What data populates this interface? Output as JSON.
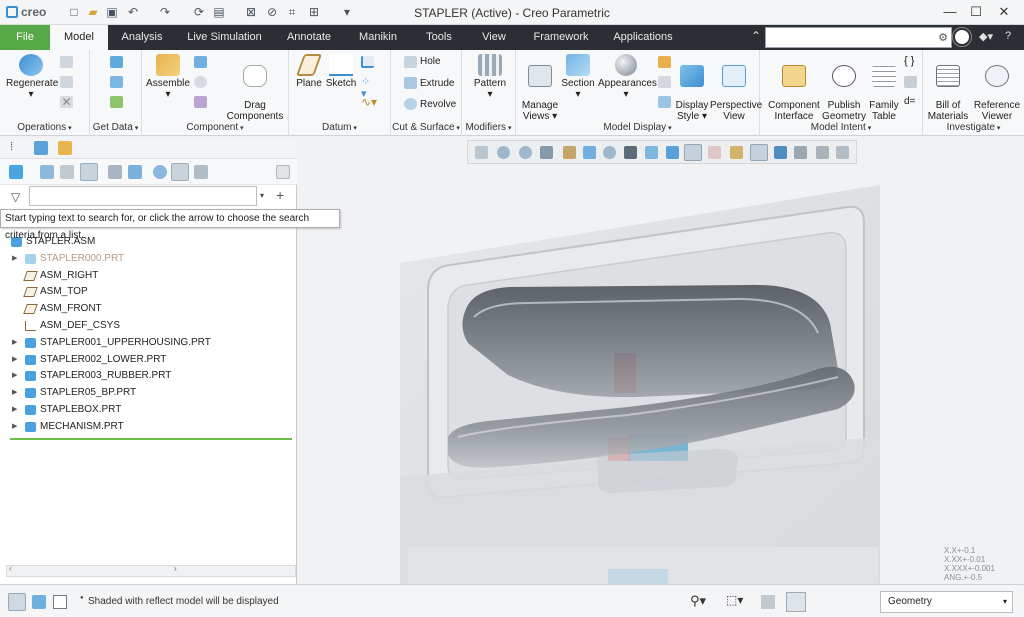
{
  "app": {
    "logo": "creo",
    "window_title": "STAPLER (Active) - Creo Parametric"
  },
  "tabs": [
    "File",
    "Model",
    "Analysis",
    "Live Simulation",
    "Annotate",
    "Manikin",
    "Tools",
    "View",
    "Framework",
    "Applications"
  ],
  "active_tab": "Model",
  "ribbon": {
    "operations": {
      "label": "Operations",
      "regenerate": "Regenerate"
    },
    "get_data": {
      "label": "Get Data"
    },
    "component": {
      "label": "Component",
      "assemble": "Assemble",
      "drag": "Drag\nComponents"
    },
    "datum": {
      "label": "Datum",
      "plane": "Plane",
      "sketch": "Sketch"
    },
    "cut_surface": {
      "label": "Cut & Surface",
      "hole": "Hole",
      "extrude": "Extrude",
      "revolve": "Revolve"
    },
    "modifiers": {
      "label": "Modifiers",
      "pattern": "Pattern"
    },
    "model_display": {
      "label": "Model Display",
      "manage_views": "Manage\nViews",
      "section": "Section",
      "appearances": "Appearances",
      "display_style": "Display\nStyle",
      "perspective_view": "Perspective\nView"
    },
    "model_intent": {
      "label": "Model Intent",
      "component_interface": "Component\nInterface",
      "publish_geometry": "Publish\nGeometry",
      "family_table": "Family\nTable"
    },
    "investigate": {
      "label": "Investigate",
      "bill_of_materials": "Bill of\nMaterials",
      "reference_viewer": "Reference\nViewer"
    }
  },
  "search": {
    "tooltip": "Start typing text to search for, or click the arrow to choose the search criteria from a list."
  },
  "tree": [
    {
      "label": "STAPLER.ASM",
      "type": "asm",
      "expand": false
    },
    {
      "label": "STAPLER000.PRT",
      "type": "part-dim",
      "expand": true
    },
    {
      "label": "ASM_RIGHT",
      "type": "plane",
      "expand": false
    },
    {
      "label": "ASM_TOP",
      "type": "plane",
      "expand": false
    },
    {
      "label": "ASM_FRONT",
      "type": "plane",
      "expand": false
    },
    {
      "label": "ASM_DEF_CSYS",
      "type": "csys",
      "expand": false
    },
    {
      "label": "STAPLER001_UPPERHOUSING.PRT",
      "type": "part",
      "expand": true
    },
    {
      "label": "STAPLER002_LOWER.PRT",
      "type": "part",
      "expand": true
    },
    {
      "label": "STAPLER003_RUBBER.PRT",
      "type": "part",
      "expand": true
    },
    {
      "label": "STAPLER05_BP.PRT",
      "type": "part",
      "expand": true
    },
    {
      "label": "STAPLEBOX.PRT",
      "type": "part",
      "expand": true
    },
    {
      "label": "MECHANISM.PRT",
      "type": "part",
      "expand": true
    }
  ],
  "tolerance": [
    "X.X+-0.1",
    "X.XX+-0.01",
    "X.XXX+-0.001",
    "ANG.+-0.5"
  ],
  "status": {
    "message": "Shaded with reflect model will be displayed"
  },
  "selection_filter": "Geometry",
  "colors": {
    "accent": "#57a846",
    "tabbar": "#2b2f33",
    "part_icon": "#4aa3df"
  }
}
